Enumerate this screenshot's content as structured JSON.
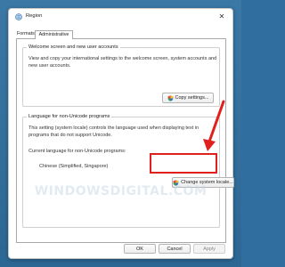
{
  "window": {
    "title": "Region",
    "close_glyph": "✕"
  },
  "tabs": [
    {
      "label": "Formats",
      "selected": false
    },
    {
      "label": "Administrative",
      "selected": true
    }
  ],
  "welcome_group": {
    "title": "Welcome screen and new user accounts",
    "description": "View and copy your international settings to the welcome screen, system accounts and new user accounts.",
    "button_label": "Copy settings..."
  },
  "nonunicode_group": {
    "title": "Language for non-Unicode programs",
    "description": "This setting (system locale) controls the language used when displaying text in programs that do not support Unicode.",
    "current_label": "Current language for non-Unicode programs:",
    "current_value": "Chinese (Simplified, Singapore)",
    "button_label": "Change system locale..."
  },
  "footer": {
    "ok": "OK",
    "cancel": "Cancel",
    "apply": "Apply"
  },
  "watermark": "WINDOWSDIGITAL.COM",
  "colors": {
    "highlight": "#e0201d",
    "background": "#2f6e9e"
  }
}
